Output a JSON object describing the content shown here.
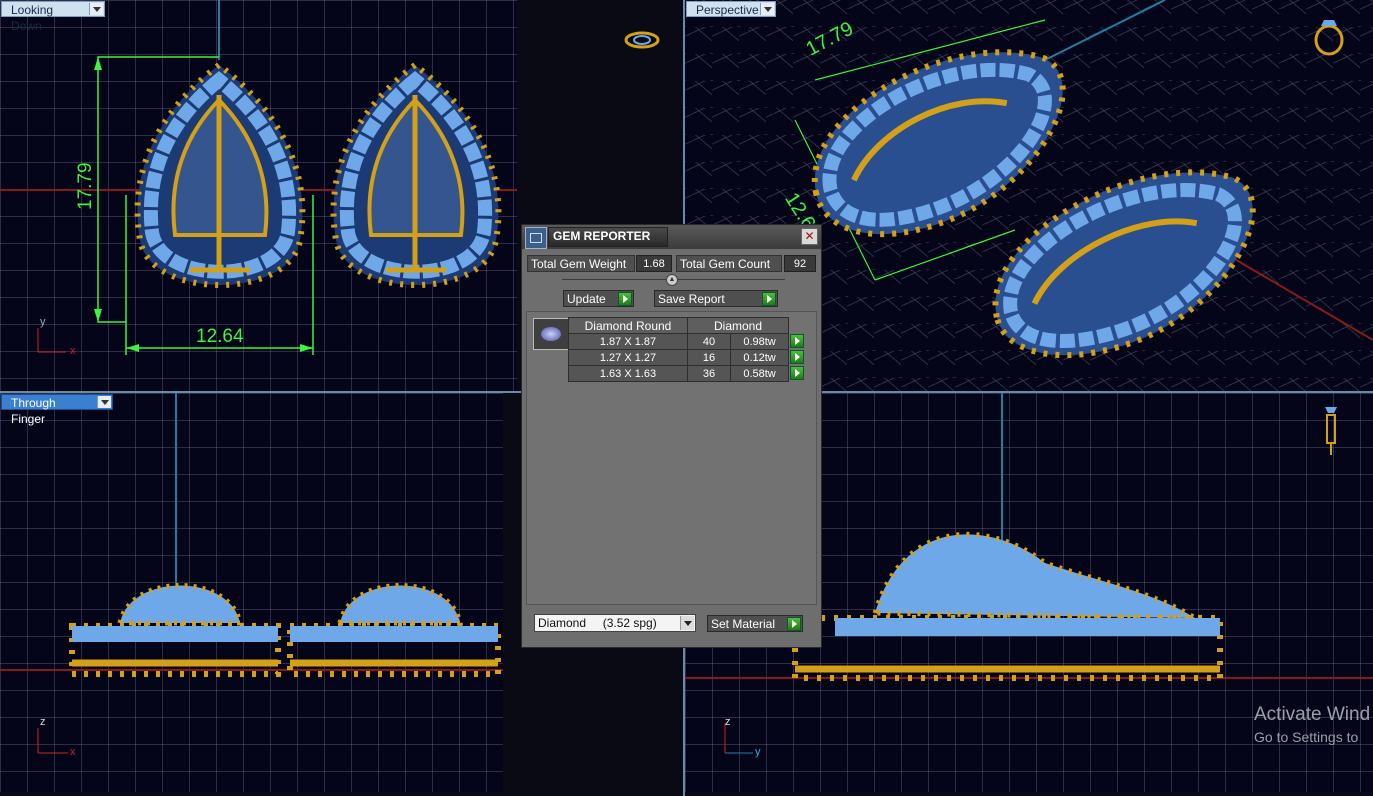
{
  "viewports": {
    "top_left": {
      "label": "Looking Down",
      "dimensions": [
        "17.79",
        "12.64"
      ],
      "axes": [
        "y",
        "x"
      ]
    },
    "top_right": {
      "label": "Perspective",
      "dimensions": [
        "17.79",
        "12.6"
      ]
    },
    "bottom_left": {
      "label": "Through Finger",
      "axes": [
        "z",
        "x"
      ]
    },
    "bottom_right": {
      "label": "",
      "axes": [
        "z",
        "y"
      ]
    }
  },
  "dialog": {
    "title": "GEM REPORTER",
    "total_gem_weight_label": "Total Gem Weight",
    "total_gem_weight": "1.68",
    "total_gem_count_label": "Total Gem Count",
    "total_gem_count": "92",
    "update_label": "Update",
    "save_report_label": "Save Report",
    "table_headers": [
      "Diamond Round",
      "",
      "Diamond"
    ],
    "rows": [
      {
        "size": "1.87 X 1.87",
        "count": "40",
        "weight": "0.98tw"
      },
      {
        "size": "1.27 X 1.27",
        "count": "16",
        "weight": "0.12tw"
      },
      {
        "size": "1.63 X 1.63",
        "count": "36",
        "weight": "0.58tw"
      }
    ],
    "material_select": "Diamond     (3.52 spg)",
    "set_material_label": "Set Material"
  },
  "watermark": {
    "line1": "Activate Wind",
    "line2": "Go to Settings to"
  },
  "colors": {
    "gold": "#d4a017",
    "gem": "#6fa8e8",
    "dim_green": "#3df53d",
    "axis_red": "#c22",
    "viewport_bg": "#05051a"
  },
  "icons": [
    "ring-top-icon",
    "ring-perspective-icon",
    "ring-side-icon",
    "dropdown-arrow-icon",
    "close-icon",
    "collapse-icon",
    "go-arrow-icon",
    "gem-thumbnail-icon"
  ]
}
